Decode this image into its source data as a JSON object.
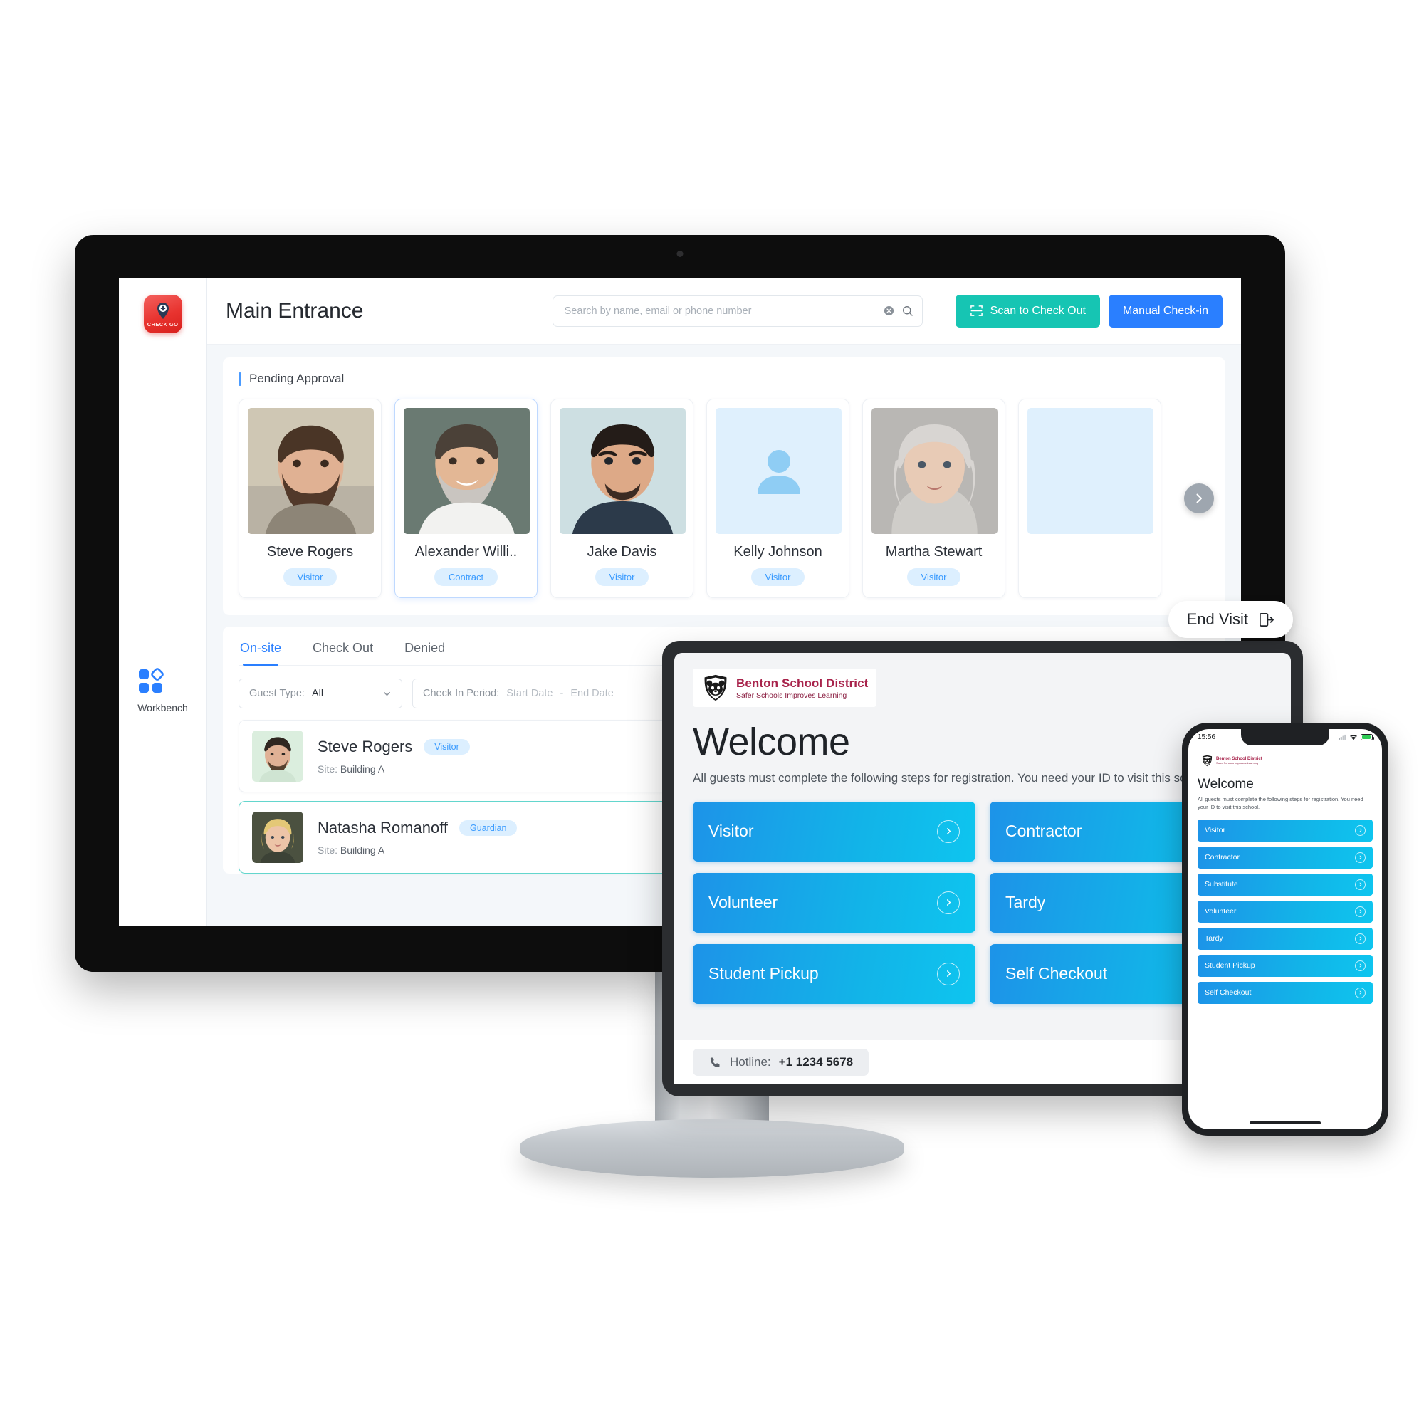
{
  "desktop": {
    "brand": {
      "name": "CHECK GO",
      "logo_icon": "red-location-pin-plus-logo"
    },
    "sidebar": {
      "items": [
        {
          "label": "Workbench",
          "icon": "workbench-grid-icon"
        }
      ]
    },
    "header": {
      "title": "Main Entrance",
      "search": {
        "placeholder": "Search by name, email or phone number",
        "value": ""
      },
      "buttons": {
        "scan_check_out": "Scan to Check Out",
        "manual_check_in": "Manual Check-in"
      },
      "colors": {
        "teal": "#16c5b3",
        "blue": "#2a7fff"
      }
    },
    "pending": {
      "section_title": "Pending Approval",
      "cards": [
        {
          "name": "Steve Rogers",
          "badge": "Visitor",
          "photo": "bearded-man-photo"
        },
        {
          "name": "Alexander Willi..",
          "badge": "Contract",
          "photo": "smiling-man-gray-beard-photo"
        },
        {
          "name": "Jake Davis",
          "badge": "Visitor",
          "photo": "young-man-dark-hair-photo"
        },
        {
          "name": "Kelly Johnson",
          "badge": "Visitor",
          "photo": "placeholder-avatar-icon"
        },
        {
          "name": "Martha Stewart",
          "badge": "Visitor",
          "photo": "older-woman-gray-hair-photo"
        }
      ],
      "next_arrow": "chevron-right-icon"
    },
    "list": {
      "tabs": [
        {
          "label": "On-site",
          "active": true
        },
        {
          "label": "Check Out",
          "active": false
        },
        {
          "label": "Denied",
          "active": false
        }
      ],
      "filters": {
        "guest_type_label": "Guest Type:",
        "guest_type_value": "All",
        "check_in_label": "Check In Period:",
        "start_date_placeholder": "Start Date",
        "date_separator": "-",
        "end_date_placeholder": "End Date"
      },
      "rows": [
        {
          "name": "Steve Rogers",
          "badge": "Visitor",
          "site_label": "Site:",
          "site_value": "Building A",
          "selected": false
        },
        {
          "name": "Natasha Romanoff",
          "badge": "Guardian",
          "site_label": "Site:",
          "site_value": "Building A",
          "selected": true
        }
      ]
    }
  },
  "tablet": {
    "logo": {
      "line1": "Benton School District",
      "line2": "Safer Schools Improves Learning",
      "icon": "bear-shield-logo"
    },
    "welcome_title": "Welcome",
    "welcome_sub": "All guests must complete the following steps for registration. You need your ID to visit this school.",
    "tiles": [
      "Visitor",
      "Contractor",
      "Volunteer",
      "Tardy",
      "Student Pickup",
      "Self Checkout"
    ],
    "hotline": {
      "label": "Hotline:",
      "number": "+1 1234 5678",
      "icon": "phone-icon"
    },
    "end_visit": {
      "label": "End Visit",
      "icon": "exit-door-icon"
    }
  },
  "phone": {
    "status": {
      "time": "15:56",
      "wifi": "wifi-icon",
      "battery": "battery-icon"
    },
    "logo": {
      "line1": "Benton School District",
      "line2": "Safer Schools Improves Learning",
      "icon": "bear-shield-logo"
    },
    "welcome_title": "Welcome",
    "welcome_sub": "All guests must complete the following steps for registration. You need your ID to visit this school.",
    "tiles": [
      "Visitor",
      "Contractor",
      "Substitute",
      "Volunteer",
      "Tardy",
      "Student Pickup",
      "Self Checkout"
    ]
  }
}
